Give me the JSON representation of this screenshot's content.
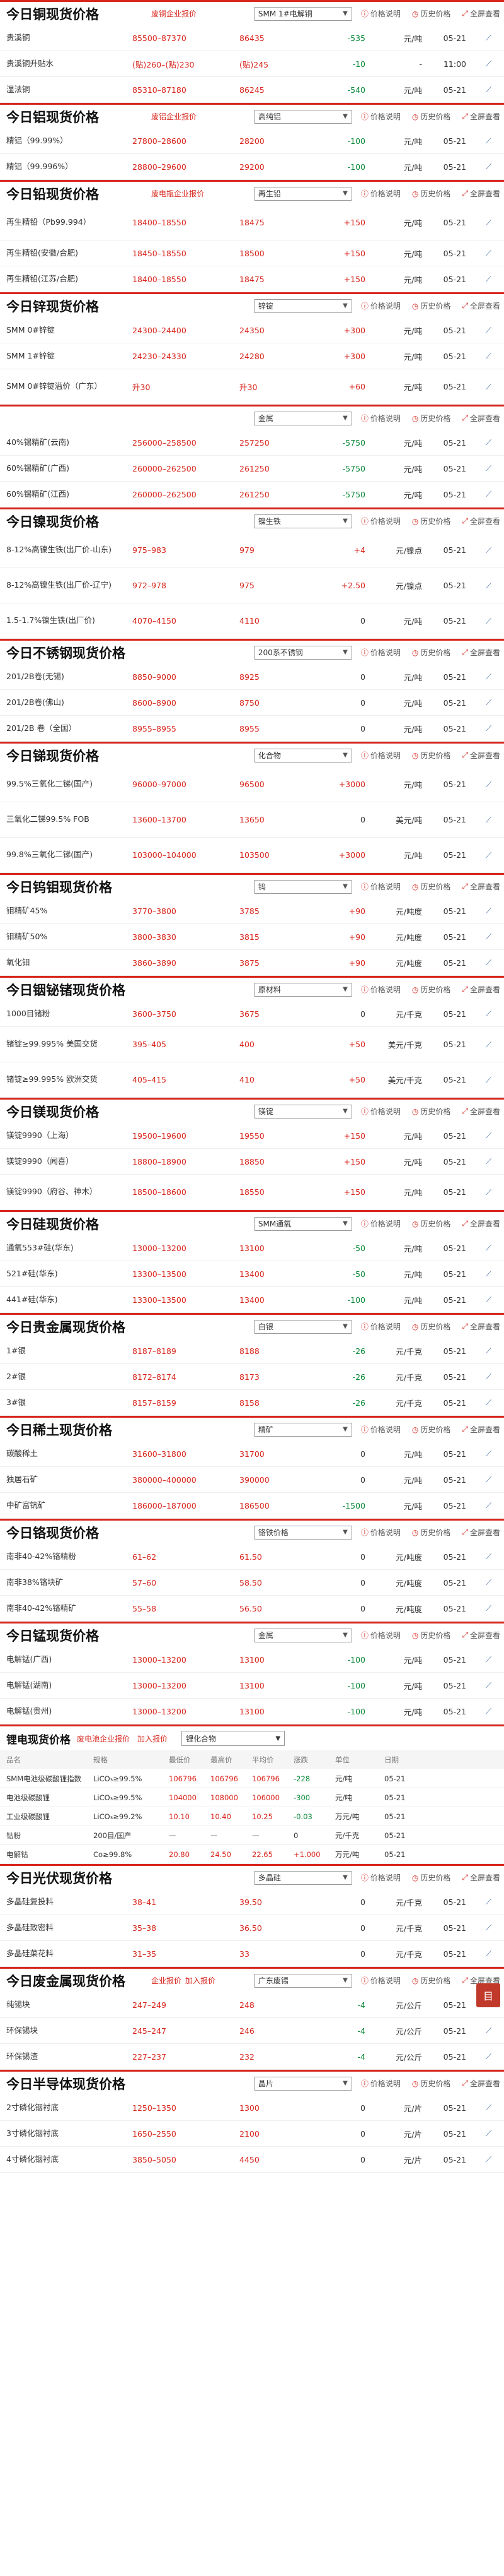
{
  "ui": {
    "explain": "价格说明",
    "history": "历史价格",
    "fullscreen": "全屏查看",
    "enterprise_quote": "企业报价",
    "join_quote": "加入报价"
  },
  "sections": [
    {
      "title": "今日铜现货价格",
      "links": [
        "废铜企业报价"
      ],
      "select": "SMM 1#电解铜",
      "rows": [
        {
          "name": "贵溪铜",
          "range": "85500–87370",
          "avg": "86435",
          "chg": "-535",
          "unit": "元/吨",
          "date": "05-21",
          "dir": "neg"
        },
        {
          "name": "贵溪铜升贴水",
          "range": "(贴)260–(贴)230",
          "avg": "(贴)245",
          "chg": "-10",
          "unit": "-",
          "date": "11:00",
          "dir": "neg"
        },
        {
          "name": "湿法铜",
          "range": "85310–87180",
          "avg": "86245",
          "chg": "-540",
          "unit": "元/吨",
          "date": "05-21",
          "dir": "neg"
        }
      ]
    },
    {
      "title": "今日铝现货价格",
      "links": [
        "废铝企业报价"
      ],
      "select": "高纯铝",
      "rows": [
        {
          "name": "精铝（99.99%）",
          "range": "27800–28600",
          "avg": "28200",
          "chg": "-100",
          "unit": "元/吨",
          "date": "05-21",
          "dir": "neg"
        },
        {
          "name": "精铝（99.996%）",
          "range": "28800–29600",
          "avg": "29200",
          "chg": "-100",
          "unit": "元/吨",
          "date": "05-21",
          "dir": "neg"
        }
      ]
    },
    {
      "title": "今日铅现货价格",
      "links": [
        "废电瓶企业报价"
      ],
      "select": "再生铅",
      "rows": [
        {
          "name": "再生精铅（Pb99.994）",
          "range": "18400–18550",
          "avg": "18475",
          "chg": "+150",
          "unit": "元/吨",
          "date": "05-21",
          "dir": "pos"
        },
        {
          "name": "再生精铅(安徽/合肥)",
          "range": "18450–18550",
          "avg": "18500",
          "chg": "+150",
          "unit": "元/吨",
          "date": "05-21",
          "dir": "pos"
        },
        {
          "name": "再生精铅(江苏/合肥)",
          "range": "18400–18550",
          "avg": "18475",
          "chg": "+150",
          "unit": "元/吨",
          "date": "05-21",
          "dir": "pos"
        }
      ]
    },
    {
      "title": "今日锌现货价格",
      "links": [],
      "select": "锌锭",
      "rows": [
        {
          "name": "SMM 0#锌锭",
          "range": "24300–24400",
          "avg": "24350",
          "chg": "+300",
          "unit": "元/吨",
          "date": "05-21",
          "dir": "pos"
        },
        {
          "name": "SMM 1#锌锭",
          "range": "24230–24330",
          "avg": "24280",
          "chg": "+300",
          "unit": "元/吨",
          "date": "05-21",
          "dir": "pos"
        },
        {
          "name": "SMM 0#锌锭溢价（广东）",
          "range": "升30",
          "avg": "升30",
          "chg": "+60",
          "unit": "元/吨",
          "date": "05-21",
          "dir": "pos"
        }
      ]
    },
    {
      "title": "",
      "links": [],
      "select": "金属",
      "rows": [
        {
          "name": "40%锡精矿(云南)",
          "range": "256000–258500",
          "avg": "257250",
          "chg": "-5750",
          "unit": "元/吨",
          "date": "05-21",
          "dir": "neg"
        },
        {
          "name": "60%锡精矿(广西)",
          "range": "260000–262500",
          "avg": "261250",
          "chg": "-5750",
          "unit": "元/吨",
          "date": "05-21",
          "dir": "neg"
        },
        {
          "name": "60%锡精矿(江西)",
          "range": "260000–262500",
          "avg": "261250",
          "chg": "-5750",
          "unit": "元/吨",
          "date": "05-21",
          "dir": "neg"
        }
      ]
    },
    {
      "title": "今日镍现货价格",
      "links": [],
      "select": "镍生铁",
      "rows": [
        {
          "name": "8-12%高镍生铁(出厂价-山东)",
          "range": "975–983",
          "avg": "979",
          "chg": "+4",
          "unit": "元/镍点",
          "date": "05-21",
          "dir": "pos"
        },
        {
          "name": "8-12%高镍生铁(出厂价-辽宁)",
          "range": "972–978",
          "avg": "975",
          "chg": "+2.50",
          "unit": "元/镍点",
          "date": "05-21",
          "dir": "pos"
        },
        {
          "name": "1.5-1.7%镍生铁(出厂价)",
          "range": "4070–4150",
          "avg": "4110",
          "chg": "0",
          "unit": "元/吨",
          "date": "05-21",
          "dir": "zero"
        }
      ]
    },
    {
      "title": "今日不锈钢现货价格",
      "links": [],
      "select": "200系不锈钢",
      "rows": [
        {
          "name": "201/2B卷(无锡)",
          "range": "8850–9000",
          "avg": "8925",
          "chg": "0",
          "unit": "元/吨",
          "date": "05-21",
          "dir": "zero"
        },
        {
          "name": "201/2B卷(佛山)",
          "range": "8600–8900",
          "avg": "8750",
          "chg": "0",
          "unit": "元/吨",
          "date": "05-21",
          "dir": "zero"
        },
        {
          "name": "201/2B 卷（全国）",
          "range": "8955–8955",
          "avg": "8955",
          "chg": "0",
          "unit": "元/吨",
          "date": "05-21",
          "dir": "zero"
        }
      ]
    },
    {
      "title": "今日锑现货价格",
      "links": [],
      "select": "化合物",
      "rows": [
        {
          "name": "99.5%三氧化二锑(国产)",
          "range": "96000–97000",
          "avg": "96500",
          "chg": "+3000",
          "unit": "元/吨",
          "date": "05-21",
          "dir": "pos"
        },
        {
          "name": "三氧化二锑99.5% FOB",
          "range": "13600–13700",
          "avg": "13650",
          "chg": "0",
          "unit": "美元/吨",
          "date": "05-21",
          "dir": "zero"
        },
        {
          "name": "99.8%三氧化二锑(国产)",
          "range": "103000–104000",
          "avg": "103500",
          "chg": "+3000",
          "unit": "元/吨",
          "date": "05-21",
          "dir": "pos"
        }
      ]
    },
    {
      "title": "今日钨钼现货价格",
      "links": [],
      "select": "钨",
      "rows": [
        {
          "name": "钼精矿45%",
          "range": "3770–3800",
          "avg": "3785",
          "chg": "+90",
          "unit": "元/吨度",
          "date": "05-21",
          "dir": "pos"
        },
        {
          "name": "钼精矿50%",
          "range": "3800–3830",
          "avg": "3815",
          "chg": "+90",
          "unit": "元/吨度",
          "date": "05-21",
          "dir": "pos"
        },
        {
          "name": "氧化钼",
          "range": "3860–3890",
          "avg": "3875",
          "chg": "+90",
          "unit": "元/吨度",
          "date": "05-21",
          "dir": "pos"
        }
      ]
    },
    {
      "title": "今日铟铋锗现货价格",
      "links": [],
      "select": "原材料",
      "rows": [
        {
          "name": "1000目锗粉",
          "range": "3600–3750",
          "avg": "3675",
          "chg": "0",
          "unit": "元/千克",
          "date": "05-21",
          "dir": "zero"
        },
        {
          "name": "锗锭≥99.995% 美国交货",
          "range": "395–405",
          "avg": "400",
          "chg": "+50",
          "unit": "美元/千克",
          "date": "05-21",
          "dir": "pos"
        },
        {
          "name": "锗锭≥99.995% 欧洲交货",
          "range": "405–415",
          "avg": "410",
          "chg": "+50",
          "unit": "美元/千克",
          "date": "05-21",
          "dir": "pos"
        }
      ]
    },
    {
      "title": "今日镁现货价格",
      "links": [],
      "select": "镁锭",
      "rows": [
        {
          "name": "镁锭9990（上海）",
          "range": "19500–19600",
          "avg": "19550",
          "chg": "+150",
          "unit": "元/吨",
          "date": "05-21",
          "dir": "pos"
        },
        {
          "name": "镁锭9990（闻喜）",
          "range": "18800–18900",
          "avg": "18850",
          "chg": "+150",
          "unit": "元/吨",
          "date": "05-21",
          "dir": "pos"
        },
        {
          "name": "镁锭9990（府谷、神木）",
          "range": "18500–18600",
          "avg": "18550",
          "chg": "+150",
          "unit": "元/吨",
          "date": "05-21",
          "dir": "pos"
        }
      ]
    },
    {
      "title": "今日硅现货价格",
      "links": [],
      "select": "SMM通氧",
      "rows": [
        {
          "name": "通氧553#硅(华东)",
          "range": "13000–13200",
          "avg": "13100",
          "chg": "-50",
          "unit": "元/吨",
          "date": "05-21",
          "dir": "neg"
        },
        {
          "name": "521#硅(华东)",
          "range": "13300–13500",
          "avg": "13400",
          "chg": "-50",
          "unit": "元/吨",
          "date": "05-21",
          "dir": "neg"
        },
        {
          "name": "441#硅(华东)",
          "range": "13300–13500",
          "avg": "13400",
          "chg": "-100",
          "unit": "元/吨",
          "date": "05-21",
          "dir": "neg"
        }
      ]
    },
    {
      "title": "今日贵金属现货价格",
      "links": [],
      "select": "白银",
      "rows": [
        {
          "name": "1#银",
          "range": "8187–8189",
          "avg": "8188",
          "chg": "-26",
          "unit": "元/千克",
          "date": "05-21",
          "dir": "neg"
        },
        {
          "name": "2#银",
          "range": "8172–8174",
          "avg": "8173",
          "chg": "-26",
          "unit": "元/千克",
          "date": "05-21",
          "dir": "neg"
        },
        {
          "name": "3#银",
          "range": "8157–8159",
          "avg": "8158",
          "chg": "-26",
          "unit": "元/千克",
          "date": "05-21",
          "dir": "neg"
        }
      ]
    },
    {
      "title": "今日稀土现货价格",
      "links": [],
      "select": "精矿",
      "rows": [
        {
          "name": "碳酸稀土",
          "range": "31600–31800",
          "avg": "31700",
          "chg": "0",
          "unit": "元/吨",
          "date": "05-21",
          "dir": "zero"
        },
        {
          "name": "独居石矿",
          "range": "380000–400000",
          "avg": "390000",
          "chg": "0",
          "unit": "元/吨",
          "date": "05-21",
          "dir": "zero"
        },
        {
          "name": "中矿富钪矿",
          "range": "186000–187000",
          "avg": "186500",
          "chg": "-1500",
          "unit": "元/吨",
          "date": "05-21",
          "dir": "neg"
        }
      ]
    },
    {
      "title": "今日铬现货价格",
      "links": [],
      "select": "铬铁价格",
      "rows": [
        {
          "name": "南非40-42%铬精粉",
          "range": "61–62",
          "avg": "61.50",
          "chg": "0",
          "unit": "元/吨度",
          "date": "05-21",
          "dir": "zero"
        },
        {
          "name": "南非38%铬块矿",
          "range": "57–60",
          "avg": "58.50",
          "chg": "0",
          "unit": "元/吨度",
          "date": "05-21",
          "dir": "zero"
        },
        {
          "name": "南非40-42%铬精矿",
          "range": "55–58",
          "avg": "56.50",
          "chg": "0",
          "unit": "元/吨度",
          "date": "05-21",
          "dir": "zero"
        }
      ]
    },
    {
      "title": "今日锰现货价格",
      "links": [],
      "select": "金属",
      "rows": [
        {
          "name": "电解锰(广西)",
          "range": "13000–13200",
          "avg": "13100",
          "chg": "-100",
          "unit": "元/吨",
          "date": "05-21",
          "dir": "neg"
        },
        {
          "name": "电解锰(湖南)",
          "range": "13000–13200",
          "avg": "13100",
          "chg": "-100",
          "unit": "元/吨",
          "date": "05-21",
          "dir": "neg"
        },
        {
          "name": "电解锰(贵州)",
          "range": "13000–13200",
          "avg": "13100",
          "chg": "-100",
          "unit": "元/吨",
          "date": "05-21",
          "dir": "neg"
        }
      ]
    }
  ],
  "lithium": {
    "title": "锂电现货价格",
    "links": [
      "废电池企业报价",
      "加入报价"
    ],
    "select": "锂化合物",
    "headers": [
      "品名",
      "规格",
      "最低价",
      "最高价",
      "平均价",
      "涨跌",
      "单位",
      "日期"
    ],
    "rows": [
      {
        "c": [
          "SMM电池级碳酸锂指数",
          "LiCO₃≥99.5%",
          "106796",
          "106796",
          "106796",
          "-228",
          "元/吨",
          "05-21"
        ],
        "dir": "neg"
      },
      {
        "c": [
          "电池级碳酸锂",
          "LiCO₃≥99.5%",
          "104000",
          "108000",
          "106000",
          "-300",
          "元/吨",
          "05-21"
        ],
        "dir": "neg"
      },
      {
        "c": [
          "工业级碳酸锂",
          "LiCO₃≥99.2%",
          "10.10",
          "10.40",
          "10.25",
          "-0.03",
          "万元/吨",
          "05-21"
        ],
        "dir": "neg"
      },
      {
        "c": [
          "钴粉",
          "200目/国产",
          "—",
          "—",
          "—",
          "0",
          "元/千克",
          "05-21"
        ],
        "dir": "zero"
      },
      {
        "c": [
          "电解钴",
          "Co≥99.8%",
          "20.80",
          "24.50",
          "22.65",
          "+1.000",
          "万元/吨",
          "05-21"
        ],
        "dir": "pos"
      }
    ]
  },
  "sections2": [
    {
      "title": "今日光伏现货价格",
      "links": [],
      "select": "多晶硅",
      "rows": [
        {
          "name": "多晶硅复投料",
          "range": "38–41",
          "avg": "39.50",
          "chg": "0",
          "unit": "元/千克",
          "date": "05-21",
          "dir": "zero"
        },
        {
          "name": "多晶硅致密料",
          "range": "35–38",
          "avg": "36.50",
          "chg": "0",
          "unit": "元/千克",
          "date": "05-21",
          "dir": "zero"
        },
        {
          "name": "多晶硅菜花料",
          "range": "31–35",
          "avg": "33",
          "chg": "0",
          "unit": "元/千克",
          "date": "05-21",
          "dir": "zero"
        }
      ]
    },
    {
      "title": "今日废金属现货价格",
      "links": [
        "企业报价",
        "加入报价"
      ],
      "select": "广东废锡",
      "rows": [
        {
          "name": "纯锡块",
          "range": "247–249",
          "avg": "248",
          "chg": "-4",
          "unit": "元/公斤",
          "date": "05-21",
          "dir": "neg"
        },
        {
          "name": "环保锡块",
          "range": "245–247",
          "avg": "246",
          "chg": "-4",
          "unit": "元/公斤",
          "date": "05-21",
          "dir": "neg"
        },
        {
          "name": "环保锡渣",
          "range": "227–237",
          "avg": "232",
          "chg": "-4",
          "unit": "元/公斤",
          "date": "05-21",
          "dir": "neg"
        }
      ]
    },
    {
      "title": "今日半导体现货价格",
      "links": [],
      "select": "晶片",
      "rows": [
        {
          "name": "2寸磷化铟衬底",
          "range": "1250–1350",
          "avg": "1300",
          "chg": "0",
          "unit": "元/片",
          "date": "05-21",
          "dir": "zero"
        },
        {
          "name": "3寸磷化铟衬底",
          "range": "1650–2550",
          "avg": "2100",
          "chg": "0",
          "unit": "元/片",
          "date": "05-21",
          "dir": "zero"
        },
        {
          "name": "4寸磷化铟衬底",
          "range": "3850–5050",
          "avg": "4450",
          "chg": "0",
          "unit": "元/片",
          "date": "05-21",
          "dir": "zero"
        }
      ]
    }
  ],
  "float_button": "目"
}
